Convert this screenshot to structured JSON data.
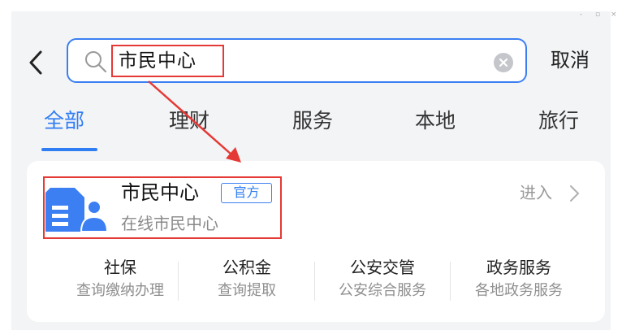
{
  "window": {
    "controls": [
      "-",
      "▫",
      "×"
    ]
  },
  "search": {
    "query": "市民中心",
    "cancel_label": "取消"
  },
  "tabs": [
    {
      "label": "全部",
      "active": true
    },
    {
      "label": "理财",
      "active": false
    },
    {
      "label": "服务",
      "active": false
    },
    {
      "label": "本地",
      "active": false
    },
    {
      "label": "旅行",
      "active": false
    }
  ],
  "result": {
    "title": "市民中心",
    "badge": "官方",
    "subtitle": "在线市民中心",
    "enter_label": "进入",
    "logo_icon": "citizen-center-logo-icon"
  },
  "services": [
    {
      "name": "社保",
      "desc": "查询缴纳办理"
    },
    {
      "name": "公积金",
      "desc": "查询提取"
    },
    {
      "name": "公安交管",
      "desc": "公安综合服务"
    },
    {
      "name": "政务服务",
      "desc": "各地政务服务"
    }
  ],
  "colors": {
    "accent": "#2f7df3",
    "annotation": "#e53935",
    "logo": "#3b7ff2"
  }
}
